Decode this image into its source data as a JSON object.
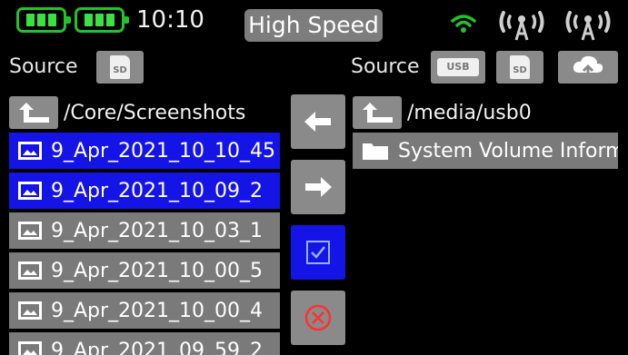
{
  "status_bar": {
    "time": "10:10",
    "speed_mode": "High Speed",
    "icons": [
      "battery-icon",
      "battery-icon",
      "wifi-icon",
      "antenna-icon",
      "antenna-icon"
    ],
    "colors": {
      "battery": "#3be043",
      "wifi": "#22c22a"
    }
  },
  "left_panel": {
    "source_label": "Source",
    "source_options": [
      "SD"
    ],
    "path": "/Core/Screenshots",
    "files": [
      {
        "name": "9_Apr_2021_10_10_45",
        "selected": true
      },
      {
        "name": "9_Apr_2021_10_09_2",
        "selected": true
      },
      {
        "name": "9_Apr_2021_10_03_1",
        "selected": false
      },
      {
        "name": "9_Apr_2021_10_00_5",
        "selected": false
      },
      {
        "name": "9_Apr_2021_10_00_4",
        "selected": false
      },
      {
        "name": "9_Apr_2021_09_59_2",
        "selected": false
      }
    ]
  },
  "right_panel": {
    "source_label": "Source",
    "source_options": [
      "USB",
      "SD",
      "cloud-icon"
    ],
    "path": "/media/usb0",
    "files": [
      {
        "name": "System Volume Inform",
        "type": "folder"
      }
    ]
  },
  "actions": {
    "buttons": [
      "left-arrow-icon",
      "right-arrow-icon",
      "checkbox-icon",
      "cancel-icon"
    ],
    "colors": {
      "default": "#8a8a8a",
      "active": "#1414e6",
      "cancel": "#ff3030"
    }
  },
  "colors": {
    "selected_row": "#1414e6",
    "normal_row": "#7a7a7a",
    "button": "#8a8a8a"
  }
}
